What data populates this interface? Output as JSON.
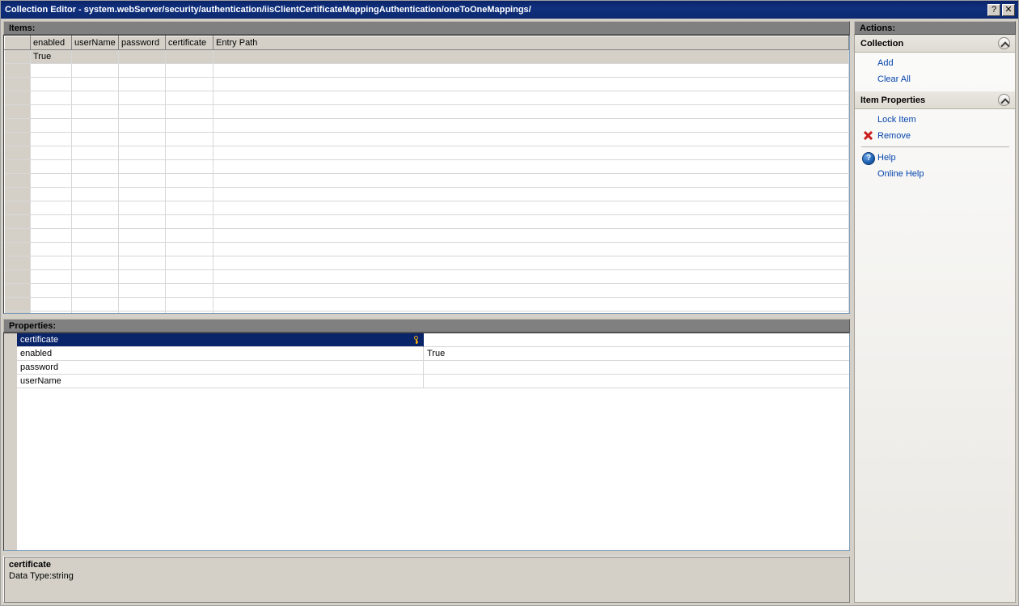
{
  "window": {
    "title": "Collection Editor - system.webServer/security/authentication/iisClientCertificateMappingAuthentication/oneToOneMappings/",
    "help_button": "?",
    "close_button": "✕"
  },
  "items": {
    "section_label": "Items:",
    "columns": [
      "",
      "enabled",
      "userName",
      "password",
      "certificate",
      "Entry Path"
    ],
    "rows": [
      {
        "selected": true,
        "cells": [
          "",
          "True",
          "",
          "",
          "",
          ""
        ]
      }
    ],
    "empty_row_count": 19
  },
  "properties": {
    "section_label": "Properties:",
    "rows": [
      {
        "name": "certificate",
        "value": "",
        "selected": true,
        "icon": "key-icon"
      },
      {
        "name": "enabled",
        "value": "True",
        "selected": false,
        "icon": ""
      },
      {
        "name": "password",
        "value": "",
        "selected": false,
        "icon": ""
      },
      {
        "name": "userName",
        "value": "",
        "selected": false,
        "icon": ""
      }
    ]
  },
  "description": {
    "title": "certificate",
    "line": "Data Type:string"
  },
  "actions": {
    "section_label": "Actions:",
    "groups": [
      {
        "title": "Collection",
        "collapse_icon": "chevron-up-icon",
        "items": [
          {
            "label": "Add",
            "icon": ""
          },
          {
            "label": "Clear All",
            "icon": ""
          }
        ]
      },
      {
        "title": "Item Properties",
        "collapse_icon": "chevron-up-icon",
        "items": [
          {
            "label": "Lock Item",
            "icon": ""
          },
          {
            "label": "Remove",
            "icon": "x-icon"
          },
          {
            "separator": true
          },
          {
            "label": "Help",
            "icon": "help-icon",
            "icon_glyph": "?"
          },
          {
            "label": "Online Help",
            "icon": ""
          }
        ]
      }
    ]
  },
  "colors": {
    "titlebar": "#0d2a70",
    "section_bar": "#808080",
    "selection": "#0a246a",
    "link": "#0645ad",
    "remove_icon": "#cc1f1f",
    "face": "#d4d0c8"
  }
}
